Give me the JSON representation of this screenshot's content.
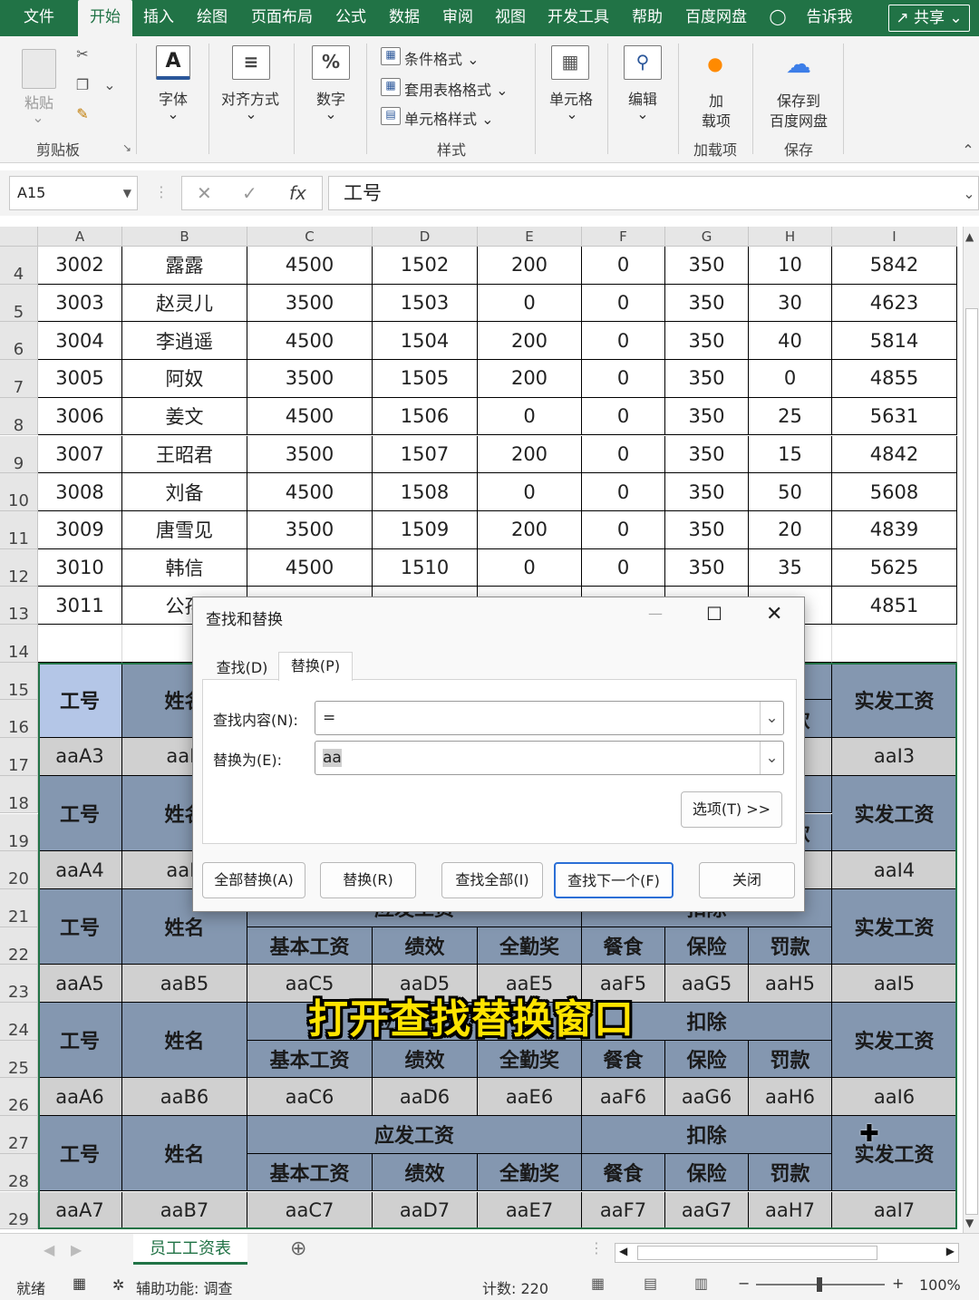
{
  "tabs": [
    "文件",
    "开始",
    "插入",
    "绘图",
    "页面布局",
    "公式",
    "数据",
    "审阅",
    "视图",
    "开发工具",
    "帮助",
    "百度网盘",
    "告诉我"
  ],
  "share_label": "共享",
  "ribbon": {
    "paste": "粘贴",
    "clipboard_group": "剪贴板",
    "font": "字体",
    "align": "对齐方式",
    "number": "数字",
    "cond_format": "条件格式",
    "table_format": "套用表格格式",
    "cell_style": "单元格样式",
    "styles_group": "样式",
    "cells": "单元格",
    "editing": "编辑",
    "addins_line1": "加",
    "addins_line2": "载项",
    "addins_group": "加载项",
    "save_line1": "保存到",
    "save_line2": "百度网盘",
    "save_group": "保存"
  },
  "formula": {
    "namebox": "A15",
    "content": "工号"
  },
  "columns": [
    "A",
    "B",
    "C",
    "D",
    "E",
    "F",
    "G",
    "H",
    "I"
  ],
  "rows": [
    {
      "n": "4",
      "v": [
        "3002",
        "露露",
        "4500",
        "1502",
        "200",
        "0",
        "350",
        "10",
        "5842"
      ]
    },
    {
      "n": "5",
      "v": [
        "3003",
        "赵灵儿",
        "3500",
        "1503",
        "0",
        "0",
        "350",
        "30",
        "4623"
      ]
    },
    {
      "n": "6",
      "v": [
        "3004",
        "李逍遥",
        "4500",
        "1504",
        "200",
        "0",
        "350",
        "40",
        "5814"
      ]
    },
    {
      "n": "7",
      "v": [
        "3005",
        "阿奴",
        "3500",
        "1505",
        "200",
        "0",
        "350",
        "0",
        "4855"
      ]
    },
    {
      "n": "8",
      "v": [
        "3006",
        "姜文",
        "4500",
        "1506",
        "0",
        "0",
        "350",
        "25",
        "5631"
      ]
    },
    {
      "n": "9",
      "v": [
        "3007",
        "王昭君",
        "3500",
        "1507",
        "200",
        "0",
        "350",
        "15",
        "4842"
      ]
    },
    {
      "n": "10",
      "v": [
        "3008",
        "刘备",
        "4500",
        "1508",
        "0",
        "0",
        "350",
        "50",
        "5608"
      ]
    },
    {
      "n": "11",
      "v": [
        "3009",
        "唐雪见",
        "3500",
        "1509",
        "200",
        "0",
        "350",
        "20",
        "4839"
      ]
    },
    {
      "n": "12",
      "v": [
        "3010",
        "韩信",
        "4500",
        "1510",
        "0",
        "0",
        "350",
        "35",
        "5625"
      ]
    },
    {
      "n": "13",
      "v": [
        "3011",
        "公孙",
        "",
        "",
        "",
        "",
        "",
        "",
        "4851"
      ]
    }
  ],
  "row_numbers_lower": [
    "14",
    "15",
    "16",
    "17",
    "18",
    "19",
    "20",
    "21",
    "22",
    "23",
    "24",
    "25",
    "26",
    "27",
    "28",
    "29"
  ],
  "header_labels": {
    "id": "工号",
    "name": "姓名",
    "payable": "应发工资",
    "deduct": "扣除",
    "net": "实发工资",
    "base": "基本工资",
    "perf": "绩效",
    "attend": "全勤奖",
    "meal": "餐食",
    "ins": "保险",
    "fine": "罚款"
  },
  "partial": {
    "name_cut": "姓名",
    "deduct_cut": "应发工资",
    "deduct_cut2": "扣除",
    "h_cut": "罚款",
    "h3_cut": "3",
    "h4_cut": "4"
  },
  "data_blocks": [
    {
      "idx": "3",
      "v": [
        "aaA3",
        "aaB",
        "",
        "",
        "",
        "",
        "",
        "",
        "aaI3"
      ]
    },
    {
      "idx": "4",
      "v": [
        "aaA4",
        "aaB",
        "",
        "",
        "",
        "",
        "",
        "",
        "aaI4"
      ]
    },
    {
      "idx": "5",
      "v": [
        "aaA5",
        "aaB5",
        "aaC5",
        "aaD5",
        "aaE5",
        "aaF5",
        "aaG5",
        "aaH5",
        "aaI5"
      ]
    },
    {
      "idx": "6",
      "v": [
        "aaA6",
        "aaB6",
        "aaC6",
        "aaD6",
        "aaE6",
        "aaF6",
        "aaG6",
        "aaH6",
        "aaI6"
      ]
    },
    {
      "idx": "7",
      "v": [
        "aaA7",
        "aaB7",
        "aaC7",
        "aaD7",
        "aaE7",
        "aaF7",
        "aaG7",
        "aaH7",
        "aaI7"
      ]
    }
  ],
  "dialog": {
    "title": "查找和替换",
    "tab_find": "查找(D)",
    "tab_replace": "替换(P)",
    "find_label": "查找内容(N):",
    "find_value": "=",
    "replace_label": "替换为(E):",
    "replace_value": "aa",
    "options": "选项(T) >>",
    "replace_all": "全部替换(A)",
    "replace": "替换(R)",
    "find_all": "查找全部(I)",
    "find_next": "查找下一个(F)",
    "close": "关闭"
  },
  "caption": "打开查找替换窗口",
  "sheet_tab": "员工工资表",
  "status": {
    "ready": "就绪",
    "access": "辅助功能: 调查",
    "count": "计数: 220",
    "zoom": "100%"
  }
}
